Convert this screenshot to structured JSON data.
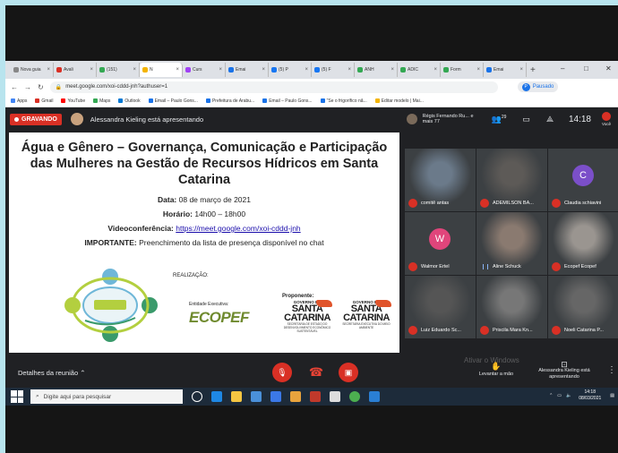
{
  "browser": {
    "tabs": [
      {
        "label": "Nova guia",
        "color": "#888"
      },
      {
        "label": "Avali",
        "color": "#d93025"
      },
      {
        "label": "(151)",
        "color": "#34a853"
      },
      {
        "label": "N",
        "color": "#f4b400"
      },
      {
        "label": "Curs",
        "color": "#a142f4"
      },
      {
        "label": "Emai",
        "color": "#1a73e8"
      },
      {
        "label": "(5) P",
        "color": "#1877f2"
      },
      {
        "label": "(5) F",
        "color": "#1877f2"
      },
      {
        "label": "ANH",
        "color": "#34a853"
      },
      {
        "label": "ADIC",
        "color": "#34a853"
      },
      {
        "label": "Form",
        "color": "#34a853"
      },
      {
        "label": "Emai",
        "color": "#1a73e8"
      }
    ],
    "url": "meet.google.com/xoi-cddd-jnh?authuser=1",
    "profile_label": "Pausado",
    "bookmarks": [
      {
        "label": "Apps",
        "color": "#4285f4"
      },
      {
        "label": "Gmail",
        "color": "#d93025"
      },
      {
        "label": "YouTube",
        "color": "#ff0000"
      },
      {
        "label": "Maps",
        "color": "#34a853"
      },
      {
        "label": "Outlook",
        "color": "#0078d4"
      },
      {
        "label": "Email – Paulo Gons...",
        "color": "#1a73e8"
      },
      {
        "label": "Prefeitura de Arabu...",
        "color": "#1a73e8"
      },
      {
        "label": "Email – Paulo Gons...",
        "color": "#1a73e8"
      },
      {
        "label": "\"Se o frigorífico nã...",
        "color": "#1a73e8"
      },
      {
        "label": "Editar modelo | Mai...",
        "color": "#f4b400"
      }
    ]
  },
  "meet": {
    "recording_label": "GRAVANDO",
    "presenting_text": "Alessandra Kieling está apresentando",
    "others_text": "Régis Fernando Ru... e mais 77",
    "participants_count": "29",
    "clock": "14:18",
    "you_label": "Você",
    "details_label": "Detalhes da reunião",
    "raise_hand_label": "Levantar a mão",
    "presenter_label": "Alessandra Kieling está apresentando",
    "activate_windows": "Ativar o Windows"
  },
  "slide": {
    "title": "Água e Gênero – Governança, Comunicação e Participação das Mulheres na Gestão de Recursos Hídricos em Santa Catarina",
    "date_label": "Data:",
    "date_value": "08 de março de 2021",
    "time_label": "Horário:",
    "time_value": "14h00 – 18h00",
    "video_label": "Videoconferência:",
    "video_link": "https://meet.google.com/xoi-cddd-jnh",
    "important_label": "IMPORTANTE:",
    "important_text": "Preenchimento da lista de presença disponível no chat",
    "realizacao": "REALIZAÇÃO:",
    "entidade": "Entidade Executiva:",
    "ecopef": "ECOPEF",
    "proponente": "Proponente:",
    "gov1": "GOVERNO DE",
    "state1": "SANTA CATARINA",
    "sub1": "SECRETARIA DE ESTADO DO DESENVOLVIMENTO ECONÔMICO SUSTENTÁVEL",
    "gov2": "GOVERNO DE",
    "state2": "SANTA CATARINA",
    "sub2": "SECRETARIA EXECUTIVA DO MEIO AMBIENTE"
  },
  "participants": [
    {
      "name": "comitê antas",
      "initial": "",
      "color": "#6b7a8a",
      "muted": true
    },
    {
      "name": "ADEMILSON BA...",
      "initial": "",
      "color": "#5d5a57",
      "muted": true
    },
    {
      "name": "Claudia schiavini",
      "initial": "C",
      "color": "#7b4fc9",
      "muted": true
    },
    {
      "name": "Walmor Ertel",
      "initial": "W",
      "color": "#e0457b",
      "muted": true
    },
    {
      "name": "Aline Schuck",
      "initial": "",
      "color": "#8a7a70",
      "muted": false
    },
    {
      "name": "Ecopef Ecopef",
      "initial": "",
      "color": "#9a9590",
      "muted": true
    },
    {
      "name": "Luiz Eduardo Sc...",
      "initial": "",
      "color": "#555",
      "muted": true
    },
    {
      "name": "Priscila Mara Kn...",
      "initial": "",
      "color": "#777",
      "muted": true
    },
    {
      "name": "Noeli Catarina P...",
      "initial": "",
      "color": "#666",
      "muted": true
    }
  ],
  "taskbar": {
    "search_placeholder": "Digite aqui para pesquisar",
    "time": "14:18",
    "date": "08/03/2021"
  }
}
